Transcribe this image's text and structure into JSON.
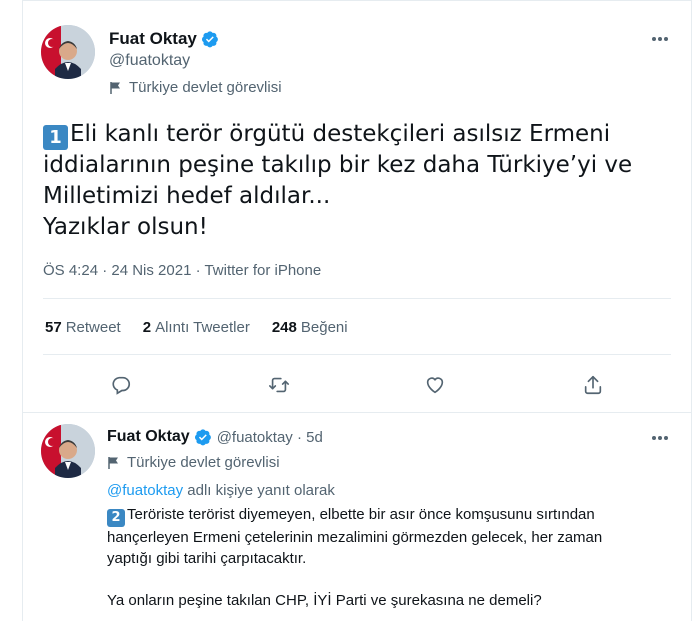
{
  "main_tweet": {
    "author_name": "Fuat Oktay",
    "author_handle": "@fuatoktay",
    "author_label": "Türkiye devlet görevlisi",
    "badge": "1",
    "text": "Eli kanlı terör örgütü destekçileri asılsız Ermeni\niddialarının peşine takılıp bir kez daha Türkiye’yi ve\nMilletimizi hedef aldılar...\nYazıklar olsun!",
    "timestamp": "ÖS 4:24 · 24 Nis 2021 · Twitter for iPhone",
    "stats": {
      "retweets_count": "57",
      "retweets_label": "Retweet",
      "quotes_count": "2",
      "quotes_label": "Alıntı Tweetler",
      "likes_count": "248",
      "likes_label": "Beğeni"
    },
    "actions": [
      "reply-icon",
      "retweet-icon",
      "heart-icon",
      "share-icon"
    ]
  },
  "reply_tweet": {
    "author_name": "Fuat Oktay",
    "author_handle_time": "@fuatoktay · 5d",
    "author_label": "Türkiye devlet görevlisi",
    "reply_to_handle": "@fuatoktay",
    "reply_to_suffix": " adlı kişiye yanıt olarak",
    "badge": "2",
    "text": "Teröriste terörist diyemeyen, elbette bir asır önce komşusunu sırtından\nhançerleyen Ermeni çetelerinin mezalimini görmezden gelecek, her zaman\nyaptığı gibi tarihi çarpıtacaktır.\n\nYa onların peşine takılan CHP, İYİ Parti ve şurekasına ne demeli?"
  },
  "colors": {
    "verified": "#1d9bf0",
    "link": "#1d9bf0",
    "secondary_text": "#536471",
    "badge_bg": "#3b88c3"
  }
}
